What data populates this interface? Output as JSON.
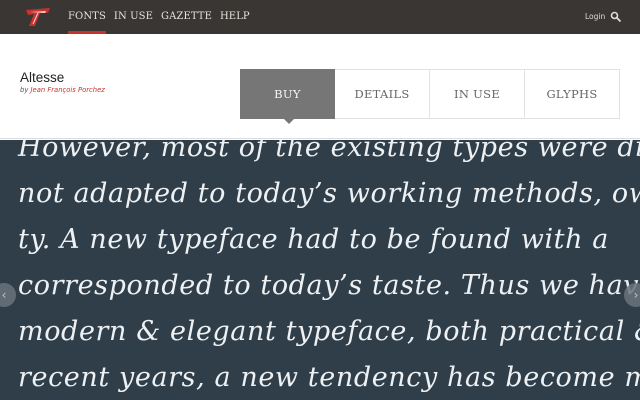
{
  "nav": {
    "items": [
      {
        "label": "FONTS",
        "active": true
      },
      {
        "label": "IN USE",
        "active": false
      },
      {
        "label": "GAZETTE",
        "active": false
      },
      {
        "label": "HELP",
        "active": false
      }
    ],
    "login_label": "Login",
    "accent_color": "#c8322e"
  },
  "header": {
    "family_name": "Altesse",
    "designer_prefix": "by",
    "designer_name": "Jean François Porchez"
  },
  "tabs": [
    {
      "label": "BUY",
      "active": true
    },
    {
      "label": "DETAILS",
      "active": false
    },
    {
      "label": "IN USE",
      "active": false
    },
    {
      "label": "GLYPHS",
      "active": false
    }
  ],
  "specimen": {
    "lines": [
      "However, most of the existing types were di",
      "not adapted to today’s working methods, owin",
      "ty. A new typeface had to be found with a",
      "corresponded to today’s taste. Thus we have c",
      "modern & elegant typeface, both practical &",
      "recent years, a new tendency has become man"
    ],
    "background_color": "#2f3e49"
  },
  "icons": {
    "logo": "logo-icon",
    "search": "search-icon",
    "prev": "chevron-left-icon",
    "next": "chevron-right-icon"
  }
}
